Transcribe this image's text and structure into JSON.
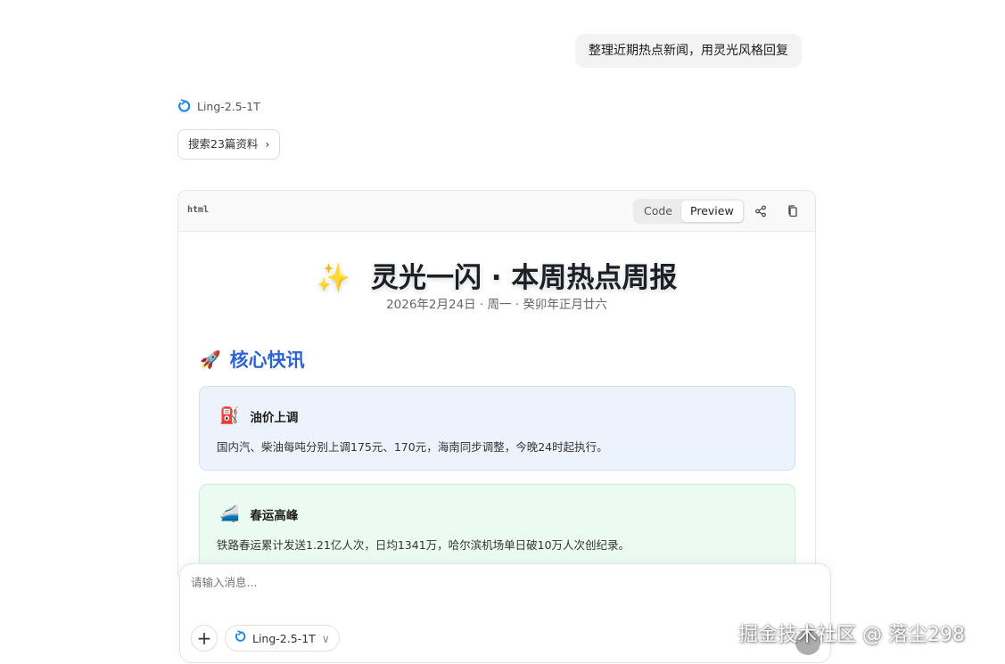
{
  "conversation": {
    "user_message": "整理近期热点新闻，用灵光风格回复",
    "model_name": "Ling-2.5-1T",
    "sources_label": "搜索23篇资料",
    "sources_chevron": "›"
  },
  "artifact": {
    "language": "html",
    "tabs": [
      "Code",
      "Preview"
    ],
    "active_tab": "Preview",
    "share_icon": "share-icon",
    "copy_icon": "copy-icon"
  },
  "preview": {
    "title_emoji": "✨",
    "title": "灵光一闪 · 本周热点周报",
    "date_line": "2026年2月24日 · 周一 · 癸卯年正月廿六",
    "section_emoji": "🚀",
    "section_title": "核心快讯",
    "cards": [
      {
        "emoji": "⛽",
        "title": "油价上调",
        "text": "国内汽、柴油每吨分别上调175元、170元，海南同步调整，今晚24时起执行。",
        "bg": "#edf3fd"
      },
      {
        "emoji": "🚄",
        "title": "春运高峰",
        "text": "铁路春运累计发送1.21亿人次，日均1341万，哈尔滨机场单日破10万人次创纪录。",
        "bg": "#ebfbf1"
      }
    ]
  },
  "composer": {
    "placeholder": "请输入消息...",
    "add_label": "+",
    "model_name": "Ling-2.5-1T",
    "model_chevron": "∨"
  },
  "watermark": "掘金技术社区 @ 落尘298",
  "colors": {
    "accent_blue": "#2f63d4",
    "logo_blue": "#1e88e5"
  }
}
